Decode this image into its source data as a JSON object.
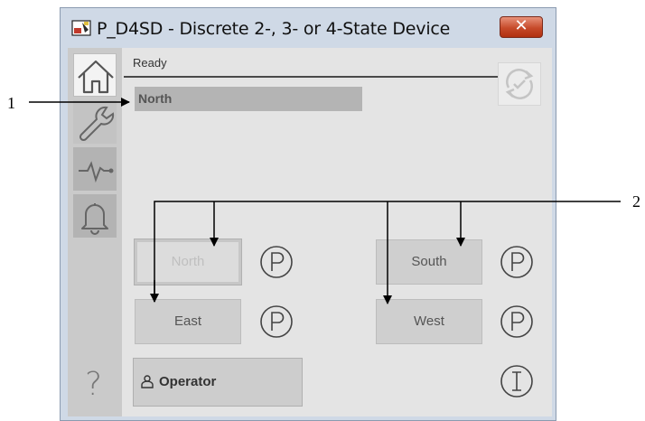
{
  "window": {
    "title": "P_D4SD - Discrete 2-, 3- or 4-State Device",
    "close_label": "✕"
  },
  "faceplate": {
    "status_text": "Ready",
    "state_indicator": "North",
    "commands": [
      {
        "label": "North",
        "enabled": false
      },
      {
        "label": "South",
        "enabled": true
      },
      {
        "label": "East",
        "enabled": true
      },
      {
        "label": "West",
        "enabled": true
      }
    ],
    "mode_label": "Operator",
    "help_label": "?"
  },
  "callouts": {
    "one": "1",
    "two": "2"
  },
  "colors": {
    "titlebar": "#cfd9e6",
    "close_button": "#c64a2a",
    "faceplate_bg": "#e4e4e4",
    "sidebar": "#cacaca"
  }
}
